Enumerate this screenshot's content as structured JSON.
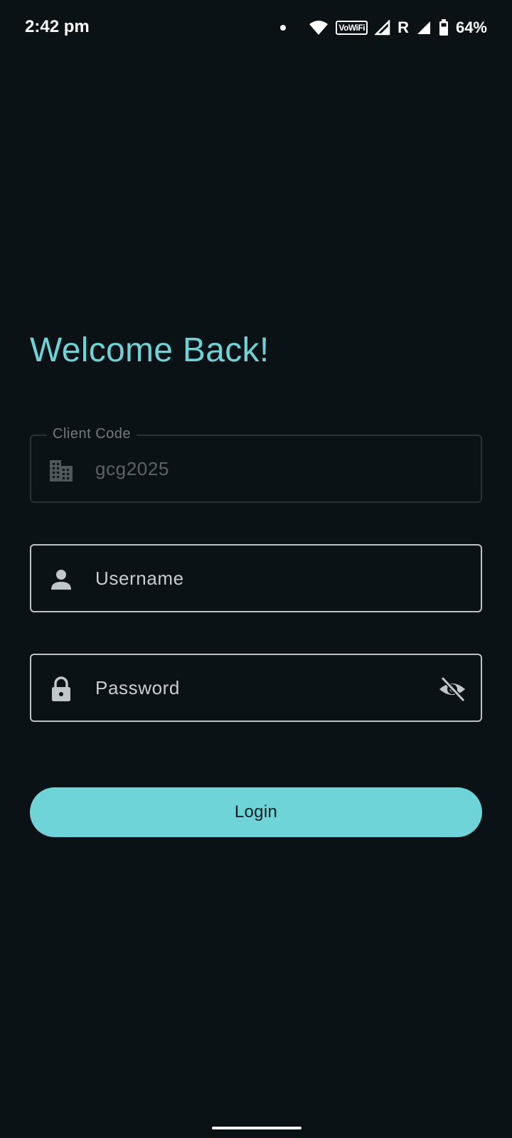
{
  "status_bar": {
    "time": "2:42 pm",
    "vowifi": "VoWiFi",
    "roaming": "R",
    "battery_percent": "64%"
  },
  "login": {
    "title": "Welcome Back!",
    "client_code": {
      "label": "Client Code",
      "value": "gcg2025",
      "icon": "building-icon"
    },
    "username": {
      "placeholder": "Username",
      "icon": "person-icon"
    },
    "password": {
      "placeholder": "Password",
      "icon": "lock-icon",
      "toggle_icon": "eye-off-icon"
    },
    "login_label": "Login"
  },
  "colors": {
    "background": "#0b1215",
    "accent": "#6ed3d6",
    "button": "#6fd4d7"
  }
}
